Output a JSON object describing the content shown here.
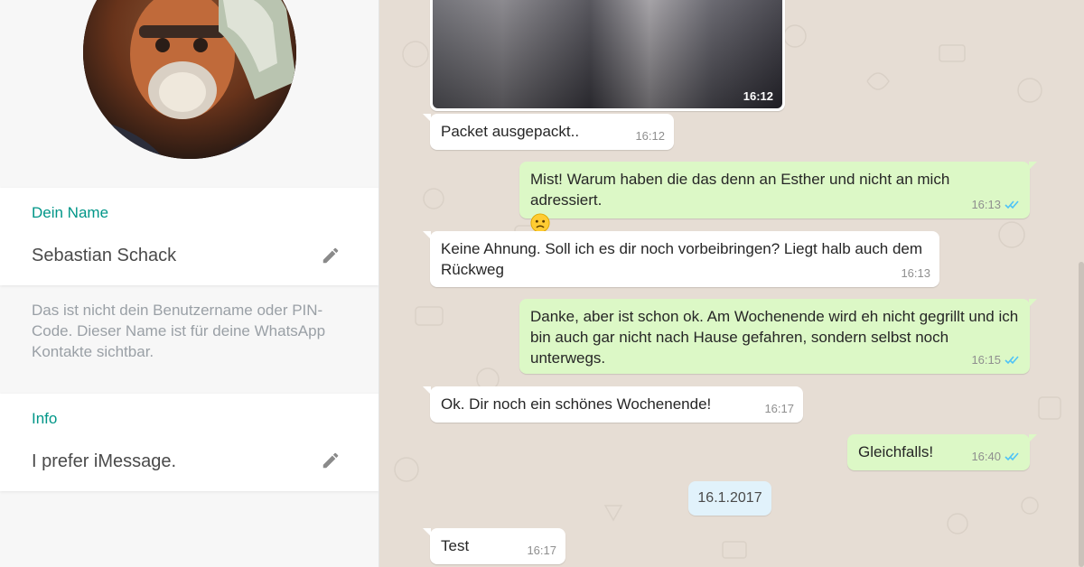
{
  "profile": {
    "name_label": "Dein Name",
    "name_value": "Sebastian Schack",
    "help_text": "Das ist nicht dein Benutzername oder PIN-Code. Dieser Name ist für deine WhatsApp Kontakte sichtbar.",
    "info_label": "Info",
    "info_value": "I prefer iMessage."
  },
  "colors": {
    "accent": "#009688",
    "outgoing_bubble": "#dcf8c6",
    "incoming_bubble": "#ffffff",
    "read_ticks": "#4fc3f7",
    "chat_background": "#e6ddd4",
    "date_chip": "#e1f2fb"
  },
  "icons": {
    "edit": "pencil-icon",
    "read_receipt": "double-check-icon",
    "emoji": "confused-face-icon"
  },
  "chat": {
    "image_message": {
      "time": "16:12"
    },
    "messages": [
      {
        "text": "Packet ausgepackt..",
        "time": "16:12",
        "direction": "in"
      },
      {
        "text": "Mist! Warum haben die das denn an Esther und nicht an mich adressiert.",
        "time": "16:13",
        "direction": "out",
        "read": true
      },
      {
        "text": "Keine Ahnung. Soll ich es dir noch vorbeibringen? Liegt halb auch dem Rückweg",
        "time": "16:13",
        "direction": "in"
      },
      {
        "text": "Danke, aber ist schon ok. Am Wochenende wird eh nicht gegrillt und ich bin auch gar nicht nach Hause gefahren, sondern selbst noch unterwegs.",
        "time": "16:15",
        "direction": "out",
        "read": true
      },
      {
        "text": "Ok. Dir noch ein schönes Wochenende!",
        "time": "16:17",
        "direction": "in"
      },
      {
        "text": "Gleichfalls!",
        "time": "16:40",
        "direction": "out",
        "read": true
      },
      {
        "text": "Test",
        "time": "16:17",
        "direction": "in"
      }
    ],
    "date_separator": "16.1.2017"
  }
}
